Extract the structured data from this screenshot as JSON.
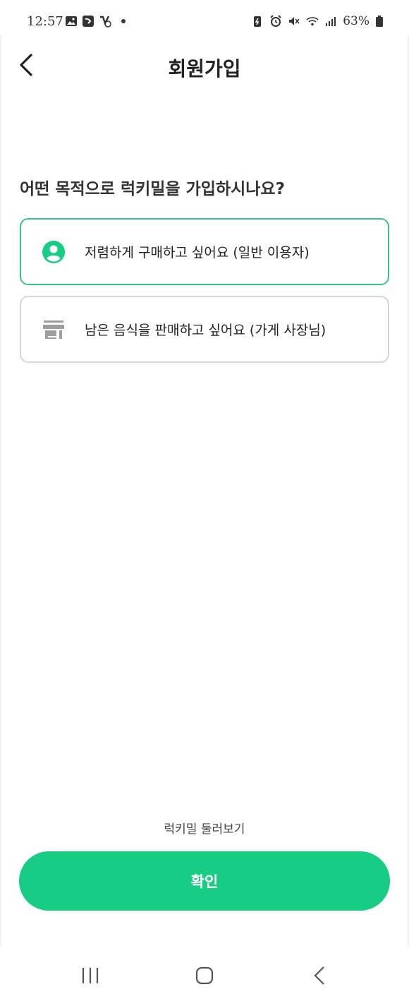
{
  "status_bar": {
    "time": "12:57",
    "battery": "63%"
  },
  "header": {
    "title": "회원가입"
  },
  "main": {
    "question": "어떤 목적으로 럭키밀을 가입하시나요?",
    "options": [
      {
        "label": "저렴하게 구매하고 싶어요 (일반 이용자)",
        "icon": "user-circle-icon",
        "selected": true
      },
      {
        "label": "남은 음식을 판매하고 싶어요 (가게 사장님)",
        "icon": "store-icon",
        "selected": false
      }
    ],
    "browse_label": "럭키밀 둘러보기",
    "confirm_label": "확인"
  },
  "colors": {
    "accent": "#17cc83",
    "selected_border": "#33c786",
    "unselected_border": "#d6d6d6",
    "inactive_icon": "#9e9e9e"
  }
}
